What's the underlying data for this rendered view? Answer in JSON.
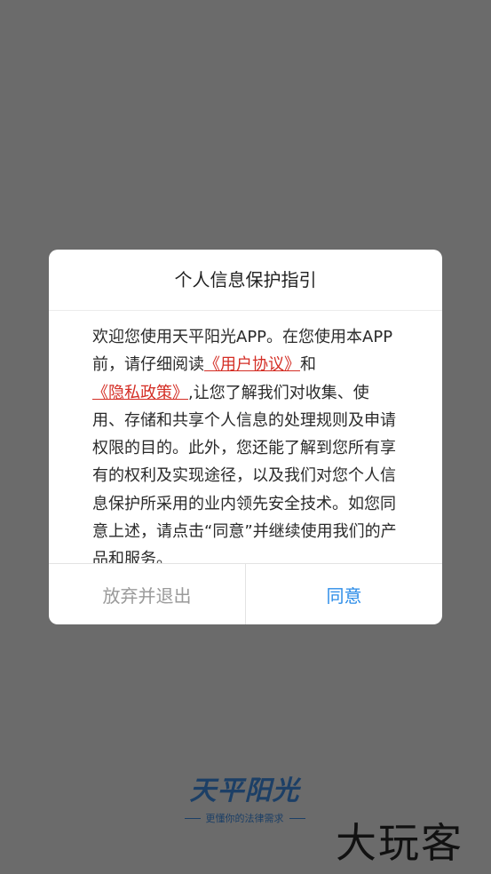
{
  "dialog": {
    "title": "个人信息保护指引",
    "body": {
      "part1": "欢迎您使用天平阳光APP。在您使用本APP前，请仔细阅读",
      "link_user_agreement": "《用户协议》",
      "part2": "和",
      "link_privacy_policy": "《隐私政策》",
      "part3": ",让您了解我们对收集、使用、存储和共享个人信息的处理规则及申请权限的目的。此外，您还能了解到您所有享有的权利及实现途径，以及我们对您个人信息保护所采用的业内领先安全技术。如您同意上述，请点击“同意”并继续使用我们的产品和服务。"
    },
    "buttons": {
      "exit": "放弃并退出",
      "agree": "同意"
    }
  },
  "brand": {
    "name": "天平阳光",
    "slogan": "更懂你的法律需求"
  },
  "watermark": "大玩客"
}
